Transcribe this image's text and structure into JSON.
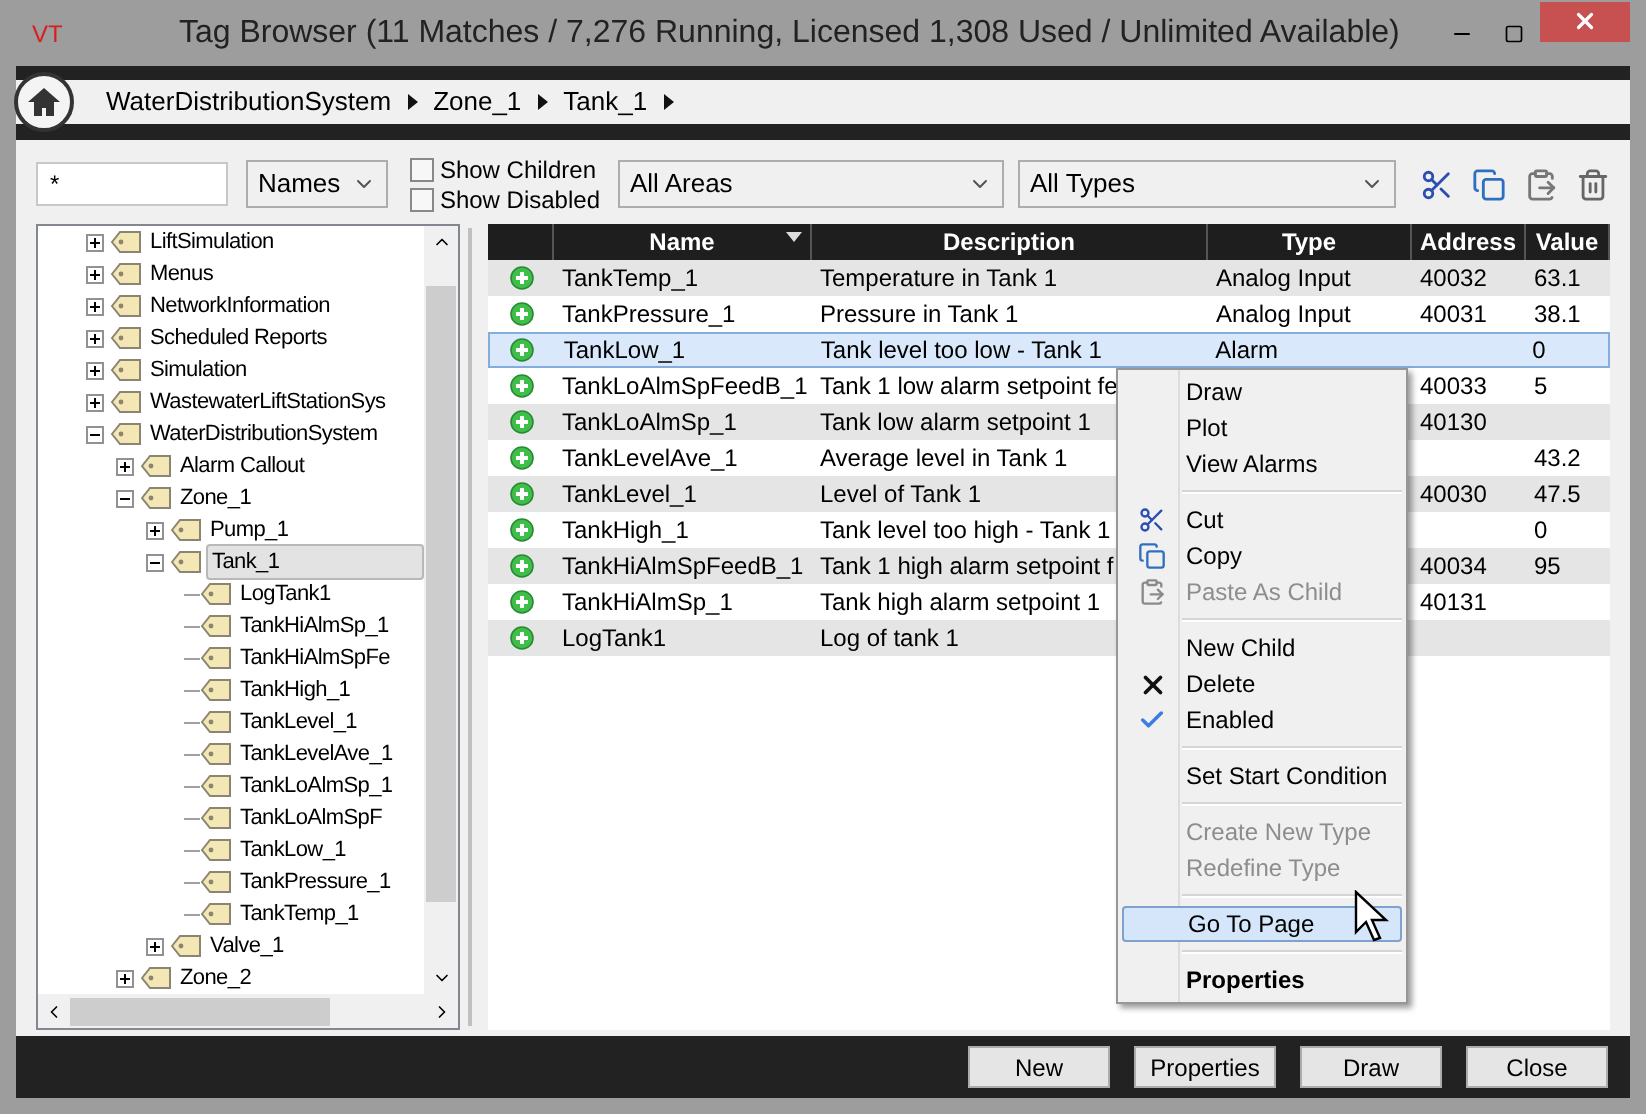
{
  "window": {
    "logo": "VT",
    "title": "Tag Browser (11 Matches / 7,276 Running, Licensed 1,308 Used / Unlimited Available)"
  },
  "breadcrumb": [
    "WaterDistributionSystem",
    "Zone_1",
    "Tank_1"
  ],
  "filters": {
    "search": {
      "value": "*"
    },
    "field_select": "Names",
    "checkboxes": [
      {
        "label": "Show Children",
        "checked": false
      },
      {
        "label": "Show Disabled",
        "checked": false
      }
    ],
    "area_select": "All Areas",
    "type_select": "All Types"
  },
  "tree": [
    {
      "label": "LiftSimulation",
      "expanded": false,
      "selected": false
    },
    {
      "label": "Menus",
      "expanded": false,
      "selected": false
    },
    {
      "label": "NetworkInformation",
      "expanded": false,
      "selected": false
    },
    {
      "label": "Scheduled Reports",
      "expanded": false,
      "selected": false
    },
    {
      "label": "Simulation",
      "expanded": false,
      "selected": false
    },
    {
      "label": "WastewaterLiftStationSys",
      "expanded": false,
      "selected": false
    },
    {
      "label": "WaterDistributionSystem",
      "expanded": true,
      "selected": false,
      "children": [
        {
          "label": "Alarm Callout",
          "expanded": false,
          "selected": false
        },
        {
          "label": "Zone_1",
          "expanded": true,
          "selected": false,
          "children": [
            {
              "label": "Pump_1",
              "expanded": false,
              "selected": false
            },
            {
              "label": "Tank_1",
              "expanded": true,
              "selected": true,
              "children": [
                {
                  "label": "LogTank1",
                  "selected": false
                },
                {
                  "label": "TankHiAlmSp_1",
                  "selected": false
                },
                {
                  "label": "TankHiAlmSpFe",
                  "selected": false
                },
                {
                  "label": "TankHigh_1",
                  "selected": false
                },
                {
                  "label": "TankLevel_1",
                  "selected": false
                },
                {
                  "label": "TankLevelAve_1",
                  "selected": false
                },
                {
                  "label": "TankLoAlmSp_1",
                  "selected": false
                },
                {
                  "label": "TankLoAlmSpF",
                  "selected": false
                },
                {
                  "label": "TankLow_1",
                  "selected": false
                },
                {
                  "label": "TankPressure_1",
                  "selected": false
                },
                {
                  "label": "TankTemp_1",
                  "selected": false
                }
              ]
            },
            {
              "label": "Valve_1",
              "expanded": false,
              "selected": false
            }
          ]
        },
        {
          "label": "Zone_2",
          "expanded": false,
          "selected": false
        }
      ]
    }
  ],
  "table": {
    "columns": [
      {
        "label": "Name",
        "sorted": true
      },
      {
        "label": "Description",
        "sorted": false
      },
      {
        "label": "Type",
        "sorted": false
      },
      {
        "label": "Address",
        "sorted": false
      },
      {
        "label": "Value",
        "sorted": false
      }
    ],
    "rows": [
      {
        "name": "TankTemp_1",
        "description": "Temperature in Tank 1",
        "type": "Analog Input",
        "address": "40032",
        "value": "63.1",
        "selected": false
      },
      {
        "name": "TankPressure_1",
        "description": "Pressure in Tank 1",
        "type": "Analog Input",
        "address": "40031",
        "value": "38.1",
        "selected": false
      },
      {
        "name": "TankLow_1",
        "description": "Tank level too low - Tank 1",
        "type": "Alarm",
        "value": "0",
        "selected": true
      },
      {
        "name": "TankLoAlmSpFeedB_1",
        "description": "Tank 1 low alarm setpoint fe",
        "address": "40033",
        "value": "5",
        "selected": false
      },
      {
        "name": "TankLoAlmSp_1",
        "description": "Tank low alarm setpoint 1",
        "address": "40130",
        "selected": false
      },
      {
        "name": "TankLevelAve_1",
        "description": "Average level in Tank 1",
        "value": "43.2",
        "selected": false
      },
      {
        "name": "TankLevel_1",
        "description": "Level of Tank 1",
        "address": "40030",
        "value": "47.5",
        "selected": false
      },
      {
        "name": "TankHigh_1",
        "description": "Tank level too high - Tank 1",
        "value": "0",
        "selected": false
      },
      {
        "name": "TankHiAlmSpFeedB_1",
        "description": "Tank 1 high alarm setpoint f",
        "address": "40034",
        "value": "95",
        "selected": false
      },
      {
        "name": "TankHiAlmSp_1",
        "description": "Tank high alarm setpoint 1",
        "address": "40131",
        "selected": false
      },
      {
        "name": "LogTank1",
        "description": "Log of tank 1",
        "selected": false
      }
    ]
  },
  "context_menu": {
    "groups": [
      [
        {
          "label": "Draw",
          "disabled": false,
          "checked": false,
          "default": false,
          "selected": false
        },
        {
          "label": "Plot",
          "disabled": false,
          "checked": false,
          "default": false,
          "selected": false
        },
        {
          "label": "View Alarms",
          "disabled": false,
          "checked": false,
          "default": false,
          "selected": false
        }
      ],
      [
        {
          "label": "Cut",
          "disabled": false,
          "checked": false,
          "default": false,
          "selected": false
        },
        {
          "label": "Copy",
          "disabled": false,
          "checked": false,
          "default": false,
          "selected": false
        },
        {
          "label": "Paste As Child",
          "disabled": true,
          "checked": false,
          "default": false,
          "selected": false
        }
      ],
      [
        {
          "label": "New Child",
          "disabled": false,
          "checked": false,
          "default": false,
          "selected": false
        },
        {
          "label": "Delete",
          "disabled": false,
          "checked": false,
          "default": false,
          "selected": false
        },
        {
          "label": "Enabled",
          "disabled": false,
          "checked": true,
          "default": false,
          "selected": false
        }
      ],
      [
        {
          "label": "Set Start Condition",
          "disabled": false,
          "checked": false,
          "default": false,
          "selected": false
        }
      ],
      [
        {
          "label": "Create New Type",
          "disabled": true,
          "checked": false,
          "default": false,
          "selected": false
        },
        {
          "label": "Redefine Type",
          "disabled": true,
          "checked": false,
          "default": false,
          "selected": false
        }
      ],
      [
        {
          "label": "Go To Page",
          "disabled": false,
          "checked": false,
          "default": false,
          "selected": true
        }
      ],
      [
        {
          "label": "Properties",
          "disabled": false,
          "checked": false,
          "default": true,
          "selected": false
        }
      ]
    ]
  },
  "buttons": [
    "New",
    "Properties",
    "Draw",
    "Close"
  ]
}
